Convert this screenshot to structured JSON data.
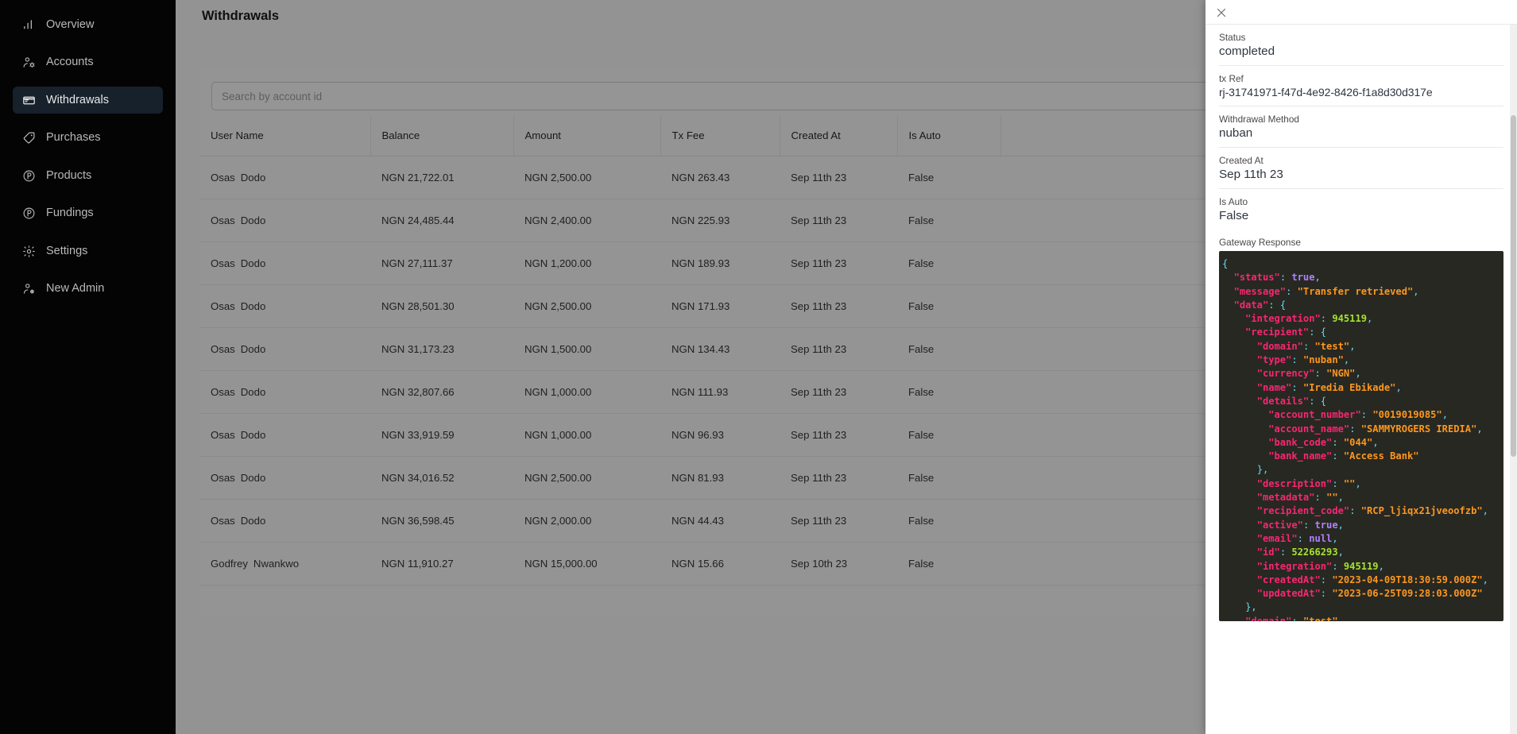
{
  "sidebar": {
    "items": [
      {
        "label": "Overview",
        "icon": "bar-chart-icon",
        "active": false
      },
      {
        "label": "Accounts",
        "icon": "user-cog-icon",
        "active": false
      },
      {
        "label": "Withdrawals",
        "icon": "card-icon",
        "active": true
      },
      {
        "label": "Purchases",
        "icon": "tag-icon",
        "active": false
      },
      {
        "label": "Products",
        "icon": "p-circle-icon",
        "active": false
      },
      {
        "label": "Fundings",
        "icon": "p-circle-icon",
        "active": false
      },
      {
        "label": "Settings",
        "icon": "gear-icon",
        "active": false
      },
      {
        "label": "New Admin",
        "icon": "user-plus-icon",
        "active": false
      }
    ]
  },
  "header": {
    "title": "Withdrawals"
  },
  "search": {
    "placeholder": "Search by account id",
    "value": ""
  },
  "table": {
    "columns": [
      "User Name",
      "Balance",
      "Amount",
      "Tx Fee",
      "Created At",
      "Is Auto",
      ""
    ],
    "rows": [
      {
        "first": "Osas",
        "last": "Dodo",
        "balance": "NGN 21,722.01",
        "amount": "NGN 2,500.00",
        "fee": "NGN 263.43",
        "created": "Sep 11th 23",
        "is_auto": "False"
      },
      {
        "first": "Osas",
        "last": "Dodo",
        "balance": "NGN 24,485.44",
        "amount": "NGN 2,400.00",
        "fee": "NGN 225.93",
        "created": "Sep 11th 23",
        "is_auto": "False"
      },
      {
        "first": "Osas",
        "last": "Dodo",
        "balance": "NGN 27,111.37",
        "amount": "NGN 1,200.00",
        "fee": "NGN 189.93",
        "created": "Sep 11th 23",
        "is_auto": "False"
      },
      {
        "first": "Osas",
        "last": "Dodo",
        "balance": "NGN 28,501.30",
        "amount": "NGN 2,500.00",
        "fee": "NGN 171.93",
        "created": "Sep 11th 23",
        "is_auto": "False"
      },
      {
        "first": "Osas",
        "last": "Dodo",
        "balance": "NGN 31,173.23",
        "amount": "NGN 1,500.00",
        "fee": "NGN 134.43",
        "created": "Sep 11th 23",
        "is_auto": "False"
      },
      {
        "first": "Osas",
        "last": "Dodo",
        "balance": "NGN 32,807.66",
        "amount": "NGN 1,000.00",
        "fee": "NGN 111.93",
        "created": "Sep 11th 23",
        "is_auto": "False"
      },
      {
        "first": "Osas",
        "last": "Dodo",
        "balance": "NGN 33,919.59",
        "amount": "NGN 1,000.00",
        "fee": "NGN 96.93",
        "created": "Sep 11th 23",
        "is_auto": "False"
      },
      {
        "first": "Osas",
        "last": "Dodo",
        "balance": "NGN 34,016.52",
        "amount": "NGN 2,500.00",
        "fee": "NGN 81.93",
        "created": "Sep 11th 23",
        "is_auto": "False"
      },
      {
        "first": "Osas",
        "last": "Dodo",
        "balance": "NGN 36,598.45",
        "amount": "NGN 2,000.00",
        "fee": "NGN 44.43",
        "created": "Sep 11th 23",
        "is_auto": "False"
      },
      {
        "first": "Godfrey",
        "last": "Nwankwo",
        "balance": "NGN 11,910.27",
        "amount": "NGN 15,000.00",
        "fee": "NGN 15.66",
        "created": "Sep 10th 23",
        "is_auto": "False"
      }
    ]
  },
  "drawer": {
    "close_icon": "close-icon",
    "fields": [
      {
        "label": "Status",
        "value": "completed"
      },
      {
        "label": "tx Ref",
        "value": "rj-31741971-f47d-4e92-8426-f1a8d30d317e"
      },
      {
        "label": "Withdrawal Method",
        "value": "nuban"
      },
      {
        "label": "Created At",
        "value": "Sep 11th 23"
      },
      {
        "label": "Is Auto",
        "value": "False"
      }
    ],
    "gateway_response_label": "Gateway Response",
    "gateway_response_lines": [
      [
        {
          "t": "brace",
          "v": "{"
        }
      ],
      [
        {
          "t": "plain",
          "v": "  "
        },
        {
          "t": "key",
          "v": "\"status\""
        },
        {
          "t": "colon",
          "v": ":"
        },
        {
          "t": "plain",
          "v": " "
        },
        {
          "t": "bool",
          "v": "true"
        },
        {
          "t": "comma",
          "v": ","
        }
      ],
      [
        {
          "t": "plain",
          "v": "  "
        },
        {
          "t": "key",
          "v": "\"message\""
        },
        {
          "t": "colon",
          "v": ":"
        },
        {
          "t": "plain",
          "v": " "
        },
        {
          "t": "str",
          "v": "\"Transfer retrieved\""
        },
        {
          "t": "comma",
          "v": ","
        }
      ],
      [
        {
          "t": "plain",
          "v": "  "
        },
        {
          "t": "key",
          "v": "\"data\""
        },
        {
          "t": "colon",
          "v": ":"
        },
        {
          "t": "plain",
          "v": " "
        },
        {
          "t": "brace",
          "v": "{"
        }
      ],
      [
        {
          "t": "plain",
          "v": "    "
        },
        {
          "t": "key",
          "v": "\"integration\""
        },
        {
          "t": "colon",
          "v": ":"
        },
        {
          "t": "plain",
          "v": " "
        },
        {
          "t": "num",
          "v": "945119"
        },
        {
          "t": "comma",
          "v": ","
        }
      ],
      [
        {
          "t": "plain",
          "v": "    "
        },
        {
          "t": "key",
          "v": "\"recipient\""
        },
        {
          "t": "colon",
          "v": ":"
        },
        {
          "t": "plain",
          "v": " "
        },
        {
          "t": "brace",
          "v": "{"
        }
      ],
      [
        {
          "t": "plain",
          "v": "      "
        },
        {
          "t": "key",
          "v": "\"domain\""
        },
        {
          "t": "colon",
          "v": ":"
        },
        {
          "t": "plain",
          "v": " "
        },
        {
          "t": "str",
          "v": "\"test\""
        },
        {
          "t": "comma",
          "v": ","
        }
      ],
      [
        {
          "t": "plain",
          "v": "      "
        },
        {
          "t": "key",
          "v": "\"type\""
        },
        {
          "t": "colon",
          "v": ":"
        },
        {
          "t": "plain",
          "v": " "
        },
        {
          "t": "str",
          "v": "\"nuban\""
        },
        {
          "t": "comma",
          "v": ","
        }
      ],
      [
        {
          "t": "plain",
          "v": "      "
        },
        {
          "t": "key",
          "v": "\"currency\""
        },
        {
          "t": "colon",
          "v": ":"
        },
        {
          "t": "plain",
          "v": " "
        },
        {
          "t": "str",
          "v": "\"NGN\""
        },
        {
          "t": "comma",
          "v": ","
        }
      ],
      [
        {
          "t": "plain",
          "v": "      "
        },
        {
          "t": "key",
          "v": "\"name\""
        },
        {
          "t": "colon",
          "v": ":"
        },
        {
          "t": "plain",
          "v": " "
        },
        {
          "t": "str",
          "v": "\"Iredia Ebikade\""
        },
        {
          "t": "comma",
          "v": ","
        }
      ],
      [
        {
          "t": "plain",
          "v": "      "
        },
        {
          "t": "key",
          "v": "\"details\""
        },
        {
          "t": "colon",
          "v": ":"
        },
        {
          "t": "plain",
          "v": " "
        },
        {
          "t": "brace",
          "v": "{"
        }
      ],
      [
        {
          "t": "plain",
          "v": "        "
        },
        {
          "t": "key",
          "v": "\"account_number\""
        },
        {
          "t": "colon",
          "v": ":"
        },
        {
          "t": "plain",
          "v": " "
        },
        {
          "t": "str",
          "v": "\"0019019085\""
        },
        {
          "t": "comma",
          "v": ","
        }
      ],
      [
        {
          "t": "plain",
          "v": "        "
        },
        {
          "t": "key",
          "v": "\"account_name\""
        },
        {
          "t": "colon",
          "v": ":"
        },
        {
          "t": "plain",
          "v": " "
        },
        {
          "t": "str",
          "v": "\"SAMMYROGERS IREDIA\""
        },
        {
          "t": "comma",
          "v": ","
        }
      ],
      [
        {
          "t": "plain",
          "v": "        "
        },
        {
          "t": "key",
          "v": "\"bank_code\""
        },
        {
          "t": "colon",
          "v": ":"
        },
        {
          "t": "plain",
          "v": " "
        },
        {
          "t": "str",
          "v": "\"044\""
        },
        {
          "t": "comma",
          "v": ","
        }
      ],
      [
        {
          "t": "plain",
          "v": "        "
        },
        {
          "t": "key",
          "v": "\"bank_name\""
        },
        {
          "t": "colon",
          "v": ":"
        },
        {
          "t": "plain",
          "v": " "
        },
        {
          "t": "str",
          "v": "\"Access Bank\""
        }
      ],
      [
        {
          "t": "plain",
          "v": "      "
        },
        {
          "t": "brace",
          "v": "}"
        },
        {
          "t": "comma",
          "v": ","
        }
      ],
      [
        {
          "t": "plain",
          "v": "      "
        },
        {
          "t": "key",
          "v": "\"description\""
        },
        {
          "t": "colon",
          "v": ":"
        },
        {
          "t": "plain",
          "v": " "
        },
        {
          "t": "str",
          "v": "\"\""
        },
        {
          "t": "comma",
          "v": ","
        }
      ],
      [
        {
          "t": "plain",
          "v": "      "
        },
        {
          "t": "key",
          "v": "\"metadata\""
        },
        {
          "t": "colon",
          "v": ":"
        },
        {
          "t": "plain",
          "v": " "
        },
        {
          "t": "str",
          "v": "\"\""
        },
        {
          "t": "comma",
          "v": ","
        }
      ],
      [
        {
          "t": "plain",
          "v": "      "
        },
        {
          "t": "key",
          "v": "\"recipient_code\""
        },
        {
          "t": "colon",
          "v": ":"
        },
        {
          "t": "plain",
          "v": " "
        },
        {
          "t": "str",
          "v": "\"RCP_ljiqx21jveoofzb\""
        },
        {
          "t": "comma",
          "v": ","
        }
      ],
      [
        {
          "t": "plain",
          "v": "      "
        },
        {
          "t": "key",
          "v": "\"active\""
        },
        {
          "t": "colon",
          "v": ":"
        },
        {
          "t": "plain",
          "v": " "
        },
        {
          "t": "bool",
          "v": "true"
        },
        {
          "t": "comma",
          "v": ","
        }
      ],
      [
        {
          "t": "plain",
          "v": "      "
        },
        {
          "t": "key",
          "v": "\"email\""
        },
        {
          "t": "colon",
          "v": ":"
        },
        {
          "t": "plain",
          "v": " "
        },
        {
          "t": "null",
          "v": "null"
        },
        {
          "t": "comma",
          "v": ","
        }
      ],
      [
        {
          "t": "plain",
          "v": "      "
        },
        {
          "t": "key",
          "v": "\"id\""
        },
        {
          "t": "colon",
          "v": ":"
        },
        {
          "t": "plain",
          "v": " "
        },
        {
          "t": "num",
          "v": "52266293"
        },
        {
          "t": "comma",
          "v": ","
        }
      ],
      [
        {
          "t": "plain",
          "v": "      "
        },
        {
          "t": "key",
          "v": "\"integration\""
        },
        {
          "t": "colon",
          "v": ":"
        },
        {
          "t": "plain",
          "v": " "
        },
        {
          "t": "num",
          "v": "945119"
        },
        {
          "t": "comma",
          "v": ","
        }
      ],
      [
        {
          "t": "plain",
          "v": "      "
        },
        {
          "t": "key",
          "v": "\"createdAt\""
        },
        {
          "t": "colon",
          "v": ":"
        },
        {
          "t": "plain",
          "v": " "
        },
        {
          "t": "str",
          "v": "\"2023-04-09T18:30:59.000Z\""
        },
        {
          "t": "comma",
          "v": ","
        }
      ],
      [
        {
          "t": "plain",
          "v": "      "
        },
        {
          "t": "key",
          "v": "\"updatedAt\""
        },
        {
          "t": "colon",
          "v": ":"
        },
        {
          "t": "plain",
          "v": " "
        },
        {
          "t": "str",
          "v": "\"2023-06-25T09:28:03.000Z\""
        }
      ],
      [
        {
          "t": "plain",
          "v": "    "
        },
        {
          "t": "brace",
          "v": "}"
        },
        {
          "t": "comma",
          "v": ","
        }
      ],
      [
        {
          "t": "plain",
          "v": "    "
        },
        {
          "t": "key",
          "v": "\"domain\""
        },
        {
          "t": "colon",
          "v": ":"
        },
        {
          "t": "plain",
          "v": " "
        },
        {
          "t": "str",
          "v": "\"test\""
        },
        {
          "t": "comma",
          "v": ","
        }
      ]
    ]
  },
  "colors": {
    "sidebar_bg": "#040404",
    "sidebar_active_bg": "#17212b",
    "code_bg": "#272822",
    "key": "#f92672",
    "string": "#fd971f",
    "number": "#a6e22e",
    "boolean": "#ae81ff",
    "brace": "#66d9ef"
  }
}
